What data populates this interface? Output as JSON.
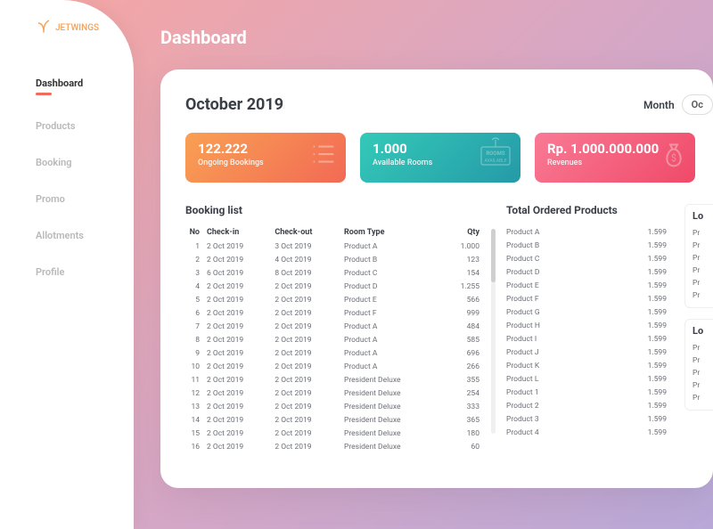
{
  "brand": "JETWINGS",
  "nav": {
    "items": [
      {
        "label": "Dashboard",
        "active": true
      },
      {
        "label": "Products",
        "active": false
      },
      {
        "label": "Booking",
        "active": false
      },
      {
        "label": "Promo",
        "active": false
      },
      {
        "label": "Allotments",
        "active": false
      },
      {
        "label": "Profile",
        "active": false
      }
    ]
  },
  "page_title": "Dashboard",
  "period_title": "October 2019",
  "month_picker": {
    "label": "Month",
    "value": "Oc"
  },
  "stats": {
    "ongoing": {
      "value": "122.222",
      "label": "Ongoing Bookings"
    },
    "rooms": {
      "value": "1.000",
      "label": "Available Rooms"
    },
    "revenue": {
      "value": "Rp. 1.000.000.000",
      "label": "Revenues"
    }
  },
  "booking_list": {
    "title": "Booking list",
    "columns": [
      "No",
      "Check-in",
      "Check-out",
      "Room Type",
      "Qty"
    ],
    "rows": [
      {
        "no": 1,
        "in": "2 Oct 2019",
        "out": "3 Oct 2019",
        "room": "Product A",
        "qty": "1.000"
      },
      {
        "no": 2,
        "in": "2 Oct 2019",
        "out": "4 Oct 2019",
        "room": "Product B",
        "qty": "123"
      },
      {
        "no": 3,
        "in": "6 Oct 2019",
        "out": "8 Oct 2019",
        "room": "Product C",
        "qty": "154"
      },
      {
        "no": 4,
        "in": "2 Oct 2019",
        "out": "2 Oct 2019",
        "room": "Product D",
        "qty": "1.255"
      },
      {
        "no": 5,
        "in": "2 Oct 2019",
        "out": "2 Oct 2019",
        "room": "Product E",
        "qty": "566"
      },
      {
        "no": 6,
        "in": "2 Oct 2019",
        "out": "2 Oct 2019",
        "room": "Product F",
        "qty": "999"
      },
      {
        "no": 7,
        "in": "2 Oct 2019",
        "out": "2 Oct 2019",
        "room": "Product A",
        "qty": "484"
      },
      {
        "no": 8,
        "in": "2 Oct 2019",
        "out": "2 Oct 2019",
        "room": "Product A",
        "qty": "585"
      },
      {
        "no": 9,
        "in": "2 Oct 2019",
        "out": "2 Oct 2019",
        "room": "Product A",
        "qty": "696"
      },
      {
        "no": 10,
        "in": "2 Oct 2019",
        "out": "2 Oct 2019",
        "room": "Product A",
        "qty": "266"
      },
      {
        "no": 11,
        "in": "2 Oct 2019",
        "out": "2 Oct 2019",
        "room": "President Deluxe",
        "qty": "355"
      },
      {
        "no": 12,
        "in": "2 Oct 2019",
        "out": "2 Oct 2019",
        "room": "President Deluxe",
        "qty": "254"
      },
      {
        "no": 13,
        "in": "2 Oct 2019",
        "out": "2 Oct 2019",
        "room": "President Deluxe",
        "qty": "333"
      },
      {
        "no": 14,
        "in": "2 Oct 2019",
        "out": "2 Oct 2019",
        "room": "President Deluxe",
        "qty": "365"
      },
      {
        "no": 15,
        "in": "2 Oct 2019",
        "out": "2 Oct 2019",
        "room": "President Deluxe",
        "qty": "180"
      },
      {
        "no": 16,
        "in": "2 Oct 2019",
        "out": "2 Oct 2019",
        "room": "President Deluxe",
        "qty": "60"
      }
    ]
  },
  "ordered_products": {
    "title": "Total Ordered Products",
    "rows": [
      {
        "name": "Product A",
        "qty": "1.599"
      },
      {
        "name": "Product B",
        "qty": "1.599"
      },
      {
        "name": "Product C",
        "qty": "1.599"
      },
      {
        "name": "Product D",
        "qty": "1.599"
      },
      {
        "name": "Product E",
        "qty": "1.599"
      },
      {
        "name": "Product F",
        "qty": "1.599"
      },
      {
        "name": "Product G",
        "qty": "1.599"
      },
      {
        "name": "Product H",
        "qty": "1.599"
      },
      {
        "name": "Product I",
        "qty": "1.599"
      },
      {
        "name": "Product J",
        "qty": "1.599"
      },
      {
        "name": "Product K",
        "qty": "1.599"
      },
      {
        "name": "Product L",
        "qty": "1.599"
      },
      {
        "name": "Product 1",
        "qty": "1.599"
      },
      {
        "name": "Product 2",
        "qty": "1.599"
      },
      {
        "name": "Product 3",
        "qty": "1.599"
      },
      {
        "name": "Product 4",
        "qty": "1.599"
      }
    ]
  },
  "remainder": {
    "block1": {
      "title": "Lo",
      "lines": [
        "Pr",
        "Pr",
        "Pr",
        "Pr",
        "Pr",
        "Pr"
      ]
    },
    "block2": {
      "title": "Lo",
      "lines": [
        "Pr",
        "Pr",
        "Pr",
        "Pr",
        "Pr"
      ]
    }
  }
}
